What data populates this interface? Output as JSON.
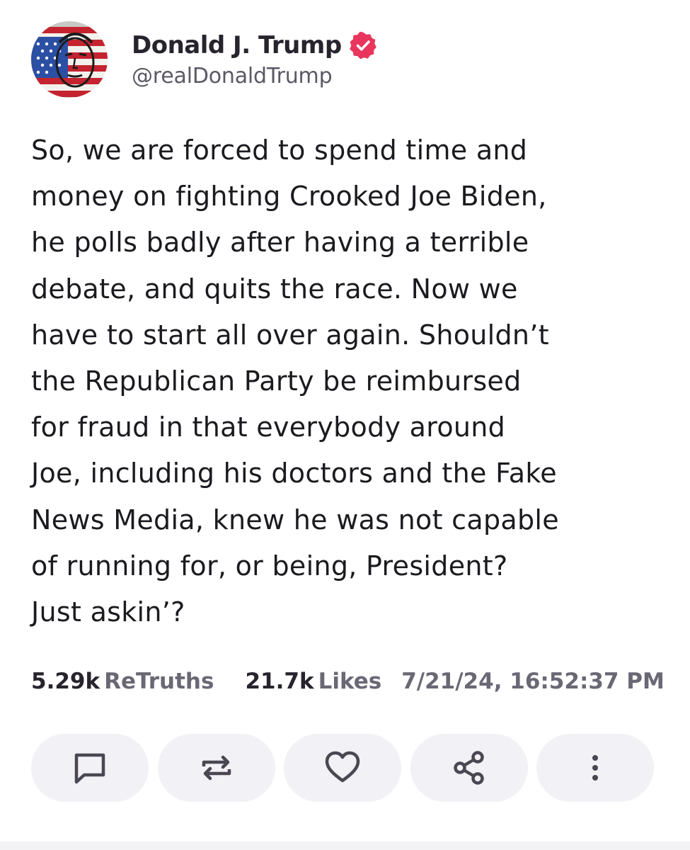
{
  "profile": {
    "display_name": "Donald J. Trump",
    "handle": "@realDonaldTrump",
    "verified": true,
    "avatar_icon": "flag-face-avatar",
    "verified_icon": "verified-badge-icon",
    "verified_color": "#e8365d"
  },
  "post": {
    "lines": [
      "So, we are forced to spend time and",
      "money on fighting Crooked Joe Biden,",
      "he polls badly after having a terrible",
      "debate, and quits the race. Now we",
      "have to start all over again. Shouldn’t",
      "the Republican Party be reimbursed",
      "for fraud in that everybody around",
      "Joe, including his doctors and the Fake",
      "News Media, knew he was not capable",
      "of running for, or being, President?",
      "Just askin’?"
    ]
  },
  "stats": {
    "retruths_count": "5.29k",
    "retruths_label": "ReTruths",
    "likes_count": "21.7k",
    "likes_label": "Likes",
    "timestamp": "7/21/24, 16:52:37 PM"
  },
  "actions": [
    {
      "icon": "reply-icon"
    },
    {
      "icon": "retruth-icon"
    },
    {
      "icon": "like-heart-icon"
    },
    {
      "icon": "share-icon"
    },
    {
      "icon": "more-options-icon"
    }
  ],
  "colors": {
    "text": "#1b1a1f",
    "muted": "#6b6875",
    "button_bg": "#f2f1f5",
    "icon": "#4a4753"
  }
}
